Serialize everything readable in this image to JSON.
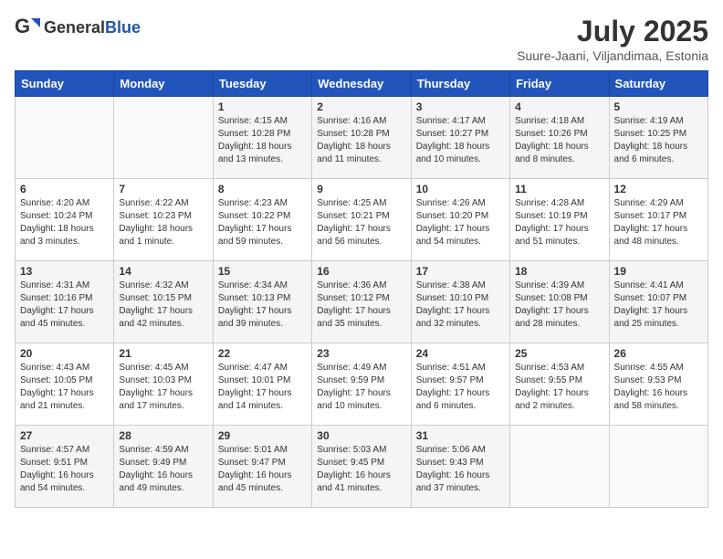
{
  "header": {
    "logo_general": "General",
    "logo_blue": "Blue",
    "month_year": "July 2025",
    "subtitle": "Suure-Jaani, Viljandimaa, Estonia"
  },
  "days_of_week": [
    "Sunday",
    "Monday",
    "Tuesday",
    "Wednesday",
    "Thursday",
    "Friday",
    "Saturday"
  ],
  "weeks": [
    [
      {
        "day": "",
        "sunrise": "",
        "sunset": "",
        "daylight": ""
      },
      {
        "day": "",
        "sunrise": "",
        "sunset": "",
        "daylight": ""
      },
      {
        "day": "1",
        "sunrise": "Sunrise: 4:15 AM",
        "sunset": "Sunset: 10:28 PM",
        "daylight": "Daylight: 18 hours and 13 minutes."
      },
      {
        "day": "2",
        "sunrise": "Sunrise: 4:16 AM",
        "sunset": "Sunset: 10:28 PM",
        "daylight": "Daylight: 18 hours and 11 minutes."
      },
      {
        "day": "3",
        "sunrise": "Sunrise: 4:17 AM",
        "sunset": "Sunset: 10:27 PM",
        "daylight": "Daylight: 18 hours and 10 minutes."
      },
      {
        "day": "4",
        "sunrise": "Sunrise: 4:18 AM",
        "sunset": "Sunset: 10:26 PM",
        "daylight": "Daylight: 18 hours and 8 minutes."
      },
      {
        "day": "5",
        "sunrise": "Sunrise: 4:19 AM",
        "sunset": "Sunset: 10:25 PM",
        "daylight": "Daylight: 18 hours and 6 minutes."
      }
    ],
    [
      {
        "day": "6",
        "sunrise": "Sunrise: 4:20 AM",
        "sunset": "Sunset: 10:24 PM",
        "daylight": "Daylight: 18 hours and 3 minutes."
      },
      {
        "day": "7",
        "sunrise": "Sunrise: 4:22 AM",
        "sunset": "Sunset: 10:23 PM",
        "daylight": "Daylight: 18 hours and 1 minute."
      },
      {
        "day": "8",
        "sunrise": "Sunrise: 4:23 AM",
        "sunset": "Sunset: 10:22 PM",
        "daylight": "Daylight: 17 hours and 59 minutes."
      },
      {
        "day": "9",
        "sunrise": "Sunrise: 4:25 AM",
        "sunset": "Sunset: 10:21 PM",
        "daylight": "Daylight: 17 hours and 56 minutes."
      },
      {
        "day": "10",
        "sunrise": "Sunrise: 4:26 AM",
        "sunset": "Sunset: 10:20 PM",
        "daylight": "Daylight: 17 hours and 54 minutes."
      },
      {
        "day": "11",
        "sunrise": "Sunrise: 4:28 AM",
        "sunset": "Sunset: 10:19 PM",
        "daylight": "Daylight: 17 hours and 51 minutes."
      },
      {
        "day": "12",
        "sunrise": "Sunrise: 4:29 AM",
        "sunset": "Sunset: 10:17 PM",
        "daylight": "Daylight: 17 hours and 48 minutes."
      }
    ],
    [
      {
        "day": "13",
        "sunrise": "Sunrise: 4:31 AM",
        "sunset": "Sunset: 10:16 PM",
        "daylight": "Daylight: 17 hours and 45 minutes."
      },
      {
        "day": "14",
        "sunrise": "Sunrise: 4:32 AM",
        "sunset": "Sunset: 10:15 PM",
        "daylight": "Daylight: 17 hours and 42 minutes."
      },
      {
        "day": "15",
        "sunrise": "Sunrise: 4:34 AM",
        "sunset": "Sunset: 10:13 PM",
        "daylight": "Daylight: 17 hours and 39 minutes."
      },
      {
        "day": "16",
        "sunrise": "Sunrise: 4:36 AM",
        "sunset": "Sunset: 10:12 PM",
        "daylight": "Daylight: 17 hours and 35 minutes."
      },
      {
        "day": "17",
        "sunrise": "Sunrise: 4:38 AM",
        "sunset": "Sunset: 10:10 PM",
        "daylight": "Daylight: 17 hours and 32 minutes."
      },
      {
        "day": "18",
        "sunrise": "Sunrise: 4:39 AM",
        "sunset": "Sunset: 10:08 PM",
        "daylight": "Daylight: 17 hours and 28 minutes."
      },
      {
        "day": "19",
        "sunrise": "Sunrise: 4:41 AM",
        "sunset": "Sunset: 10:07 PM",
        "daylight": "Daylight: 17 hours and 25 minutes."
      }
    ],
    [
      {
        "day": "20",
        "sunrise": "Sunrise: 4:43 AM",
        "sunset": "Sunset: 10:05 PM",
        "daylight": "Daylight: 17 hours and 21 minutes."
      },
      {
        "day": "21",
        "sunrise": "Sunrise: 4:45 AM",
        "sunset": "Sunset: 10:03 PM",
        "daylight": "Daylight: 17 hours and 17 minutes."
      },
      {
        "day": "22",
        "sunrise": "Sunrise: 4:47 AM",
        "sunset": "Sunset: 10:01 PM",
        "daylight": "Daylight: 17 hours and 14 minutes."
      },
      {
        "day": "23",
        "sunrise": "Sunrise: 4:49 AM",
        "sunset": "Sunset: 9:59 PM",
        "daylight": "Daylight: 17 hours and 10 minutes."
      },
      {
        "day": "24",
        "sunrise": "Sunrise: 4:51 AM",
        "sunset": "Sunset: 9:57 PM",
        "daylight": "Daylight: 17 hours and 6 minutes."
      },
      {
        "day": "25",
        "sunrise": "Sunrise: 4:53 AM",
        "sunset": "Sunset: 9:55 PM",
        "daylight": "Daylight: 17 hours and 2 minutes."
      },
      {
        "day": "26",
        "sunrise": "Sunrise: 4:55 AM",
        "sunset": "Sunset: 9:53 PM",
        "daylight": "Daylight: 16 hours and 58 minutes."
      }
    ],
    [
      {
        "day": "27",
        "sunrise": "Sunrise: 4:57 AM",
        "sunset": "Sunset: 9:51 PM",
        "daylight": "Daylight: 16 hours and 54 minutes."
      },
      {
        "day": "28",
        "sunrise": "Sunrise: 4:59 AM",
        "sunset": "Sunset: 9:49 PM",
        "daylight": "Daylight: 16 hours and 49 minutes."
      },
      {
        "day": "29",
        "sunrise": "Sunrise: 5:01 AM",
        "sunset": "Sunset: 9:47 PM",
        "daylight": "Daylight: 16 hours and 45 minutes."
      },
      {
        "day": "30",
        "sunrise": "Sunrise: 5:03 AM",
        "sunset": "Sunset: 9:45 PM",
        "daylight": "Daylight: 16 hours and 41 minutes."
      },
      {
        "day": "31",
        "sunrise": "Sunrise: 5:06 AM",
        "sunset": "Sunset: 9:43 PM",
        "daylight": "Daylight: 16 hours and 37 minutes."
      },
      {
        "day": "",
        "sunrise": "",
        "sunset": "",
        "daylight": ""
      },
      {
        "day": "",
        "sunrise": "",
        "sunset": "",
        "daylight": ""
      }
    ]
  ]
}
